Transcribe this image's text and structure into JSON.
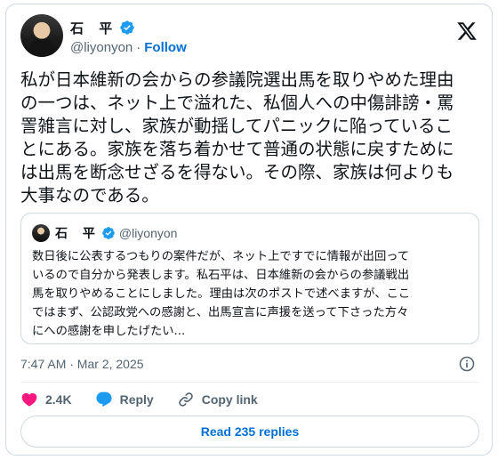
{
  "author": {
    "display_name": "石 平",
    "handle": "@liyonyon",
    "follow_label": "Follow",
    "separator": "·"
  },
  "tweet": {
    "text": "私が日本維新の会からの参議院選出馬を取りやめた理由\nの一つは、ネット上で溢れた、私個人への中傷誹謗・罵\n詈雑言に対し、家族が動揺してパニックに陥っているこ\nとにある。家族を落ち着かせて普通の状態に戻すために\nは出馬を断念せざるを得ない。その際、家族は何よりも\n大事なのである。"
  },
  "quoted_tweet": {
    "display_name": "石 平",
    "handle": "@liyonyon",
    "text": "数日後に公表するつもりの案件だが、ネット上ですでに情報が出回って\nいるので自分から発表します。私石平は、日本維新の会からの参議戦出\n馬を取りやめることにしました。理由は次のポストで述べますが、ここ\nではまず、公認政党への感謝と、出馬宣言に声援を送って下さった方々\nにへの感謝を申したげたい..."
  },
  "meta": {
    "timestamp": "7:47 AM · Mar 2, 2025"
  },
  "actions": {
    "like_count": "2.4K",
    "reply_label": "Reply",
    "copy_link_label": "Copy link"
  },
  "read_replies_label": "Read 235 replies",
  "colors": {
    "accent": "#006fd6",
    "like": "#f91880",
    "reply": "#1d9bf0",
    "muted": "#536471",
    "border": "#cfd9de",
    "verified": "#1d9bf0"
  },
  "icons": [
    "verified-badge-icon",
    "x-logo-icon",
    "info-icon",
    "heart-icon",
    "reply-bubble-icon",
    "link-icon"
  ]
}
